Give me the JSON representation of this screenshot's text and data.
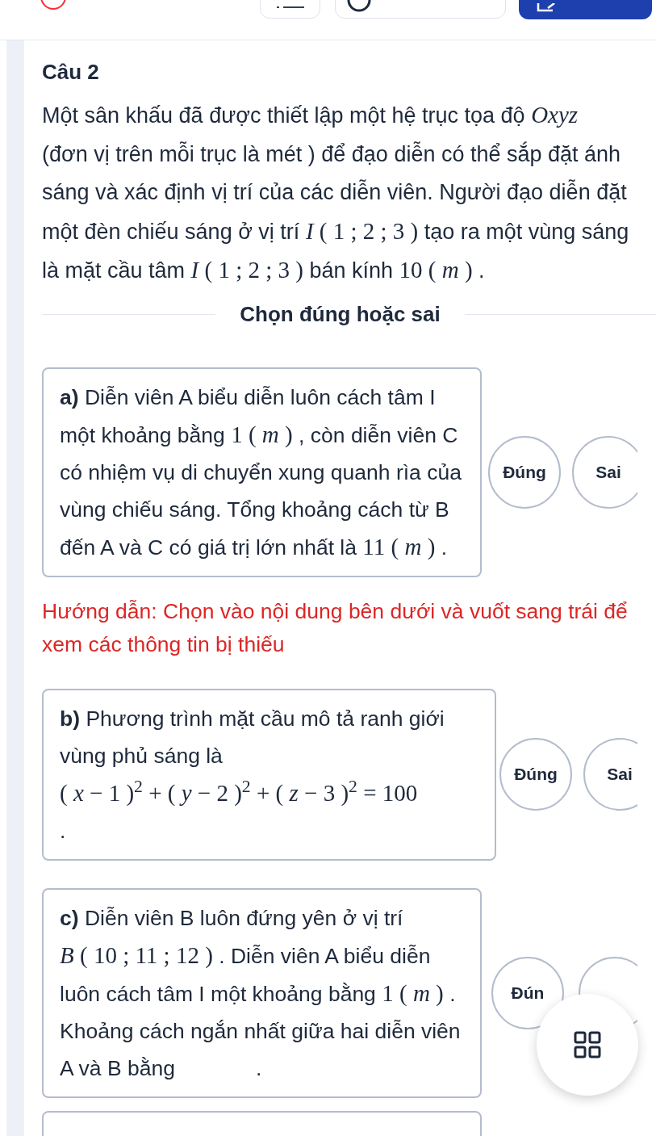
{
  "title": "Câu 2",
  "question": [
    {
      "kind": "text",
      "text": "Một sân khấu đã được thiết lập một hệ trục tọa độ "
    },
    {
      "kind": "math",
      "text": "*Oxyz*"
    },
    {
      "kind": "text",
      "text": " (đơn vị trên mỗi trục là mét ) để đạo diễn có thể sắp đặt ánh sáng và xác định vị trí của các diễn viên. Người đạo diễn đặt một đèn chiếu sáng ở vị trí "
    },
    {
      "kind": "math",
      "text": "*I* ( 1 ; 2 ; 3 )"
    },
    {
      "kind": "text",
      "text": " tạo ra một vùng sáng là mặt cầu tâm "
    },
    {
      "kind": "math",
      "text": "*I* ( 1 ; 2 ; 3 )"
    },
    {
      "kind": "text",
      "text": " bán kính "
    },
    {
      "kind": "math",
      "text": "10 ( *m* )"
    },
    {
      "kind": "text",
      "text": " ."
    }
  ],
  "section_label": "Chọn đúng hoặc sai",
  "hint": "Hướng dẫn: Chọn vào nội dung bên dưới và vuốt sang trái để xem các thông tin bị thiếu",
  "statements": [
    {
      "content": [
        {
          "kind": "text",
          "text": "**a)** Diễn viên A biểu diễn luôn cách tâm I một khoảng bằng "
        },
        {
          "kind": "math",
          "text": "1 ( *m* )"
        },
        {
          "kind": "text",
          "text": " , còn diễn viên C có nhiệm vụ di chuyển xung quanh rìa của vùng chiếu sáng. Tổng khoảng cách từ B đến A và C có giá trị lớn nhất là "
        },
        {
          "kind": "math",
          "text": "11 ( *m* )"
        },
        {
          "kind": "text",
          "text": " ."
        }
      ],
      "options": [
        {
          "label": "Đúng",
          "selected": false
        },
        {
          "label": "Sai",
          "selected": false
        }
      ]
    },
    {
      "content": [
        {
          "kind": "text",
          "text": "**b)** Phương trình mặt cầu mô tả ranh giới vùng phủ sáng là "
        },
        {
          "kind": "math",
          "text": "( *x* − 1 )$^{2}$ + ( *y* − 2 )$^{2}$ + ( *z* − 3 )$^{2}$ = 100"
        },
        {
          "kind": "break"
        },
        {
          "kind": "text",
          "text": "."
        }
      ],
      "options": [
        {
          "label": "Đúng",
          "selected": false
        },
        {
          "label": "Sai",
          "selected": false
        }
      ]
    },
    {
      "content": [
        {
          "kind": "text",
          "text": "**c)** Diễn viên B luôn đứng yên ở vị trí "
        },
        {
          "kind": "math",
          "text": "*B* ( 10 ; 11 ; 12 )"
        },
        {
          "kind": "text",
          "text": " . Diễn viên A biểu diễn luôn cách tâm I một khoảng bằng "
        },
        {
          "kind": "math",
          "text": "1 ( *m* )"
        },
        {
          "kind": "text",
          "text": " . Khoảng cách ngắn nhất giữa hai diễn viên A và B bằng"
        },
        {
          "kind": "blank"
        },
        {
          "kind": "text",
          "text": "."
        }
      ],
      "options": [
        {
          "label": "Đún",
          "selected": false
        },
        {
          "selected": false
        }
      ]
    }
  ]
}
